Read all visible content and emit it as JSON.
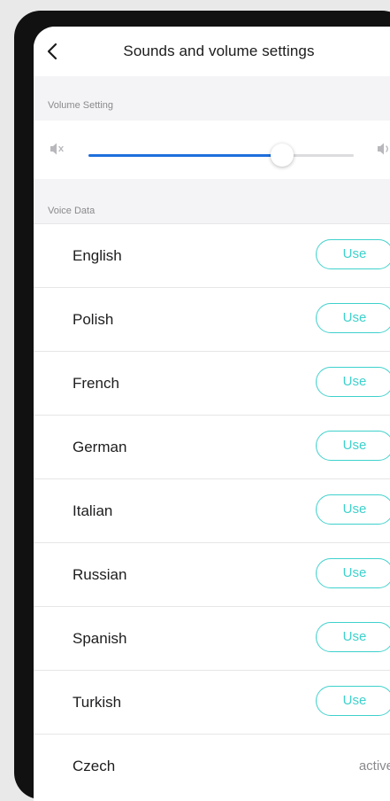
{
  "header": {
    "title": "Sounds and volume settings",
    "back_icon": "chevron-left-icon"
  },
  "volume": {
    "section_label": "Volume Setting",
    "level_percent": 73,
    "mute_icon": "speaker-muted-icon",
    "loud_icon": "speaker-loud-icon",
    "accent_color": "#1f6fdc"
  },
  "voice": {
    "section_label": "Voice Data",
    "button_color": "#3ed1cc",
    "items": [
      {
        "name": "English",
        "action": "Use"
      },
      {
        "name": "Polish",
        "action": "Use"
      },
      {
        "name": "French",
        "action": "Use"
      },
      {
        "name": "German",
        "action": "Use"
      },
      {
        "name": "Italian",
        "action": "Use"
      },
      {
        "name": "Russian",
        "action": "Use"
      },
      {
        "name": "Spanish",
        "action": "Use"
      },
      {
        "name": "Turkish",
        "action": "Use"
      },
      {
        "name": "Czech",
        "status": "active"
      }
    ]
  }
}
